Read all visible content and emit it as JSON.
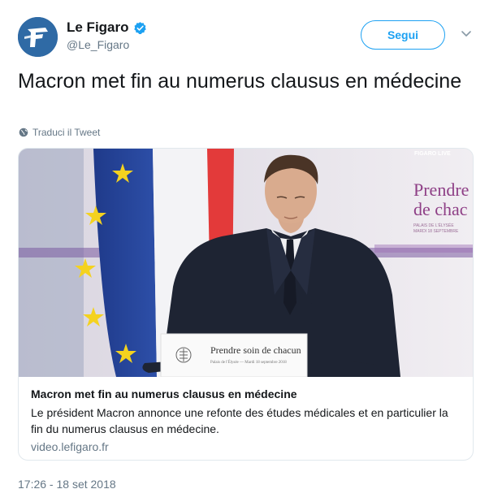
{
  "account": {
    "display_name": "Le Figaro",
    "handle": "@Le_Figaro",
    "verified": true,
    "avatar_letter": "F"
  },
  "follow_button": {
    "label": "Segui"
  },
  "tweet": {
    "text": "Macron met fin au numerus clausus en médecine",
    "translate_label": "Traduci il Tweet",
    "timestamp": "17:26 - 18 set 2018"
  },
  "card": {
    "title": "Macron met fin au numerus clausus en médecine",
    "description": "Le président Macron annonce une refonte des études médicales et en particulier la fin du numerus clausus en médecine.",
    "domain": "video.lefigaro.fr",
    "image": {
      "backdrop_line1": "Prendre",
      "backdrop_line2": "de chac",
      "backdrop_small1": "PALAIS DE L'ÉLYSÉE",
      "backdrop_small2": "MARDI 18 SEPTEMBRE",
      "podium_text": "Prendre soin de chacun",
      "podium_subtext": "Palais de l'Élysée — Mardi 18 septembre 2018",
      "watermark": "FIGARO LIVE"
    }
  },
  "colors": {
    "accent": "#1da1f2",
    "secondary_text": "#657786",
    "border": "#e1e8ed",
    "avatar_bg": "#2f6aa5"
  },
  "icons": {
    "verified": "verified-badge-icon",
    "chevron": "chevron-down-icon",
    "globe": "globe-icon"
  }
}
